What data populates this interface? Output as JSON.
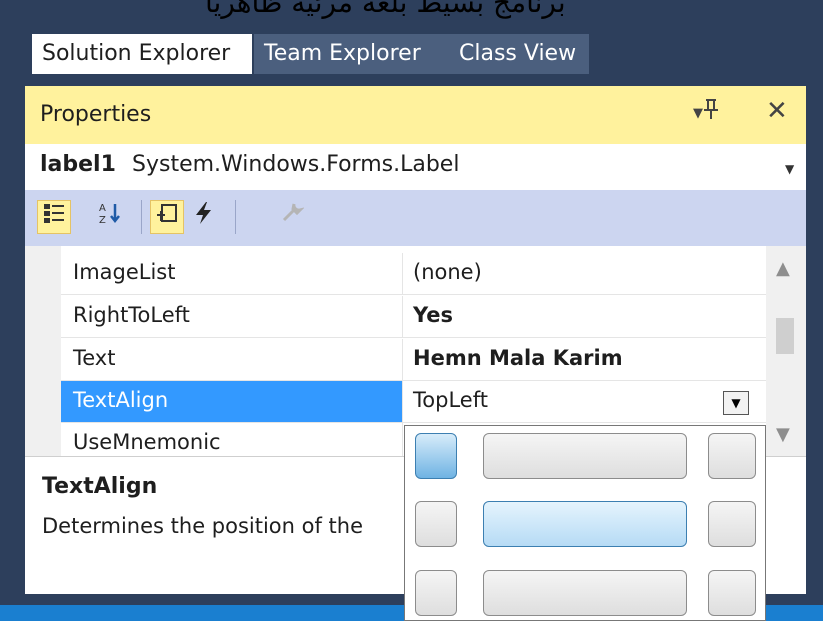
{
  "top_text": "برنامج بسيط بلغة مرئية ظاهرياً",
  "tabs": [
    {
      "label": "Solution Explorer"
    },
    {
      "label": "Team Explorer"
    },
    {
      "label": "Class View"
    }
  ],
  "properties_panel": {
    "title": "Properties",
    "pin_glyph": "ꟸ",
    "close_glyph": "✕",
    "menu_arrow": "▼"
  },
  "object_selector": {
    "name": "label1",
    "type": "System.Windows.Forms.Label"
  },
  "toolbar": {
    "categorized_icon": "categorized-icon",
    "alphabetical_icon": "alphabetical-icon",
    "properties_icon": "properties-icon",
    "events_icon": "lightning-icon",
    "property_pages_icon": "wrench-icon"
  },
  "grid_rows": [
    {
      "name": "ImageList",
      "value": "(none)",
      "bold": false
    },
    {
      "name": "RightToLeft",
      "value": "Yes",
      "bold": true
    },
    {
      "name": "Text",
      "value": "Hemn Mala Karim",
      "bold": true
    },
    {
      "name": "TextAlign",
      "value": "TopLeft",
      "bold": false,
      "selected": true
    },
    {
      "name": "UseMnemonic",
      "value": "",
      "bold": false
    }
  ],
  "description": {
    "title": "TextAlign",
    "text": "Determines the position of the"
  },
  "alignment_picker": {
    "selected": "TopLeft",
    "hover": "MiddleCenter"
  },
  "colors": {
    "frame": "#2d3f5c",
    "header": "#fff29d",
    "toolbar": "#ccd5f0",
    "selection": "#3399ff"
  }
}
